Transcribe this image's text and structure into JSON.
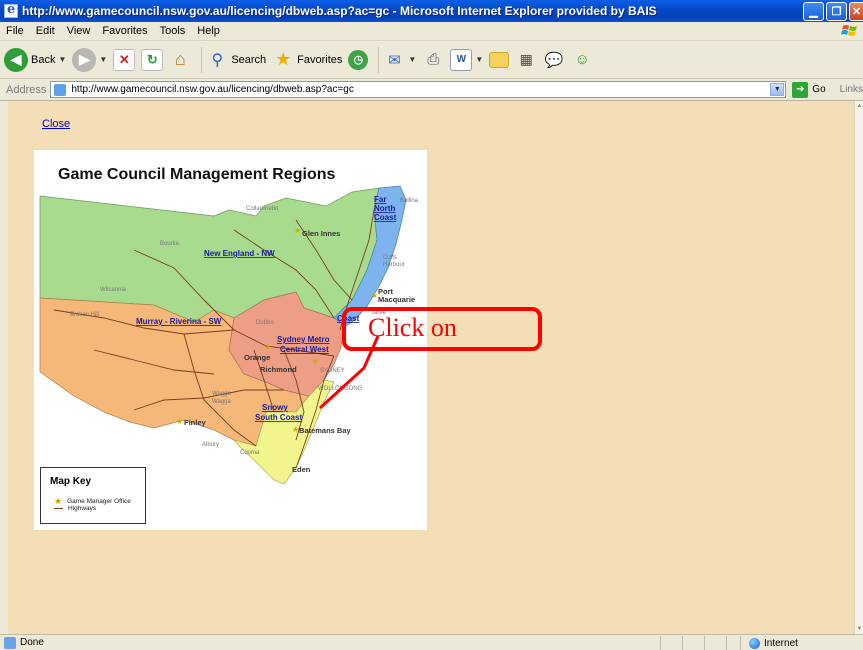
{
  "window": {
    "title": "http://www.gamecouncil.nsw.gov.au/licencing/dbweb.asp?ac=gc - Microsoft Internet Explorer provided by BAIS"
  },
  "menu": {
    "items": [
      "File",
      "Edit",
      "View",
      "Favorites",
      "Tools",
      "Help"
    ]
  },
  "toolbar": {
    "back_label": "Back",
    "search_label": "Search",
    "favorites_label": "Favorites"
  },
  "address": {
    "label": "Address",
    "url": "http://www.gamecouncil.nsw.gov.au/licencing/dbweb.asp?ac=gc",
    "go_label": "Go",
    "links_label": "Links"
  },
  "page": {
    "close_link": "Close",
    "map_title": "Game Council Management Regions",
    "regions": {
      "new_england": "New England - NW",
      "murray": "Murray - Riverina - SW",
      "sydney_metro_1": "Sydney Metro",
      "sydney_metro_2": "Central West",
      "snowy_1": "Snowy",
      "snowy_2": "South Coast",
      "far_north_1": "Far",
      "far_north_2": "North",
      "far_north_3": "Coast",
      "mid_north_2": "Coast"
    },
    "towns": {
      "collarenebri": "Collarenebri",
      "bourke": "Bourke",
      "wilcannia": "Wilcannia",
      "broken_hill": "Broken Hill",
      "dubbo": "Dubbo",
      "wagga_1": "Wagga",
      "wagga_2": "Wagga",
      "albury": "Albury",
      "cooma": "Cooma",
      "ballina": "Ballina",
      "coffs_1": "Coffs",
      "coffs_2": "Harbour",
      "taree": "Taree",
      "sydney": "SYDNEY",
      "wollongong": "WOLLONGONG"
    },
    "cities": {
      "glen_innes": "Glen Innes",
      "port_1": "Port",
      "port_2": "Macquarie",
      "orange": "Orange",
      "richmond": "Richmond",
      "finley": "Finley",
      "batemans_bay": "Batemans Bay",
      "eden": "Eden"
    },
    "map_key": {
      "title": "Map Key",
      "office": "Game Manager Office",
      "highways": "Highways"
    },
    "callout_text": "Click on"
  },
  "status": {
    "text": "Done",
    "zone": "Internet"
  },
  "colors": {
    "page_bg": "#F4DEB6",
    "callout": "#FF0000",
    "region_green": "#A8DB8E",
    "region_orange": "#F6B878",
    "region_salmon": "#EF9E86",
    "region_yellow": "#F2F58E",
    "region_blue": "#7DB4F0"
  }
}
